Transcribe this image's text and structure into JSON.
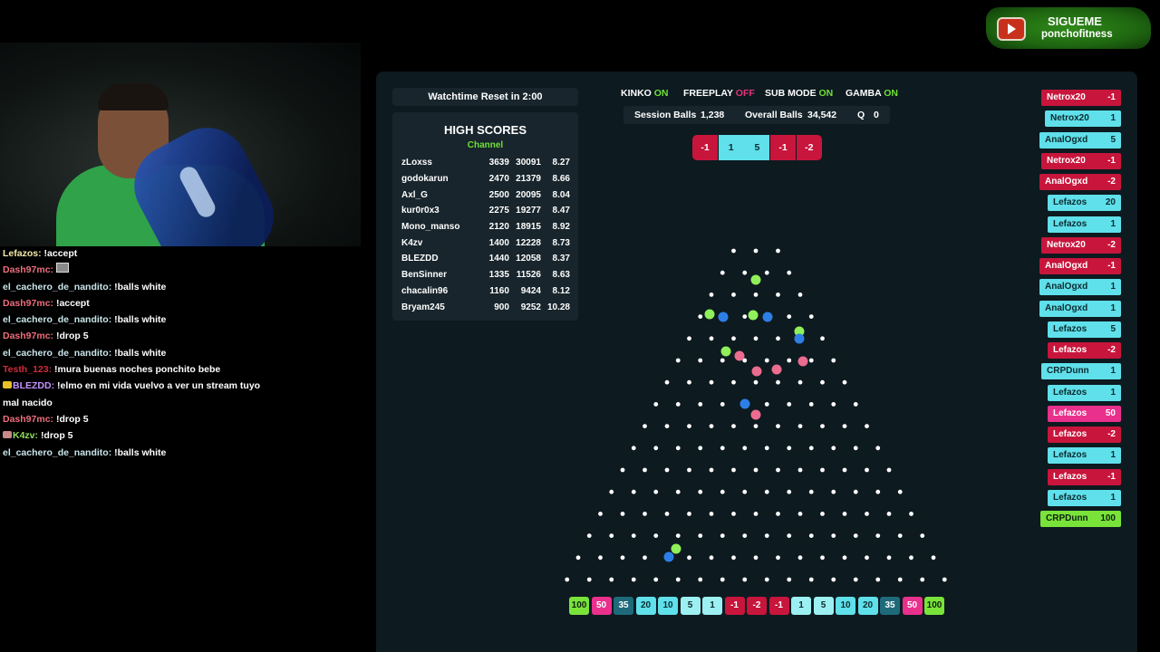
{
  "colors": {
    "panel_bg": "#0d1a20",
    "box_bg": "#18252c",
    "green": "#79e33a",
    "magenta": "#e8308c",
    "teal_dark": "#1e6a7a",
    "cyan": "#5fe0ea",
    "cyan_light": "#9cf0f2",
    "red": "#c8153c",
    "peg": "#ffffff",
    "ball_green": "#8ff05a",
    "ball_blue": "#2d7fe6",
    "ball_pink": "#ea6c8e"
  },
  "follow": {
    "line1": "SIGUEME",
    "line2": "ponchofitness",
    "icon": "youtube-icon"
  },
  "chat": [
    {
      "user": "Lefazos:",
      "color": "#f5e9a8",
      "msg": "!accept"
    },
    {
      "user": "Dash97mc:",
      "color": "#ee6e7e",
      "msg": "",
      "emote": "emote-icon"
    },
    {
      "user": "el_cachero_de_nandito:",
      "color": "#c9e6ea",
      "msg": "!balls white"
    },
    {
      "user": "Dash97mc:",
      "color": "#ee6e7e",
      "msg": "!accept"
    },
    {
      "user": "el_cachero_de_nandito:",
      "color": "#c9e6ea",
      "msg": "!balls white"
    },
    {
      "user": "Dash97mc:",
      "color": "#ee6e7e",
      "msg": "!drop 5"
    },
    {
      "user": "el_cachero_de_nandito:",
      "color": "#c9e6ea",
      "msg": "!balls white"
    },
    {
      "user": "Testh_123:",
      "color": "#d12a3c",
      "msg": "!mura buenas noches ponchito bebe"
    },
    {
      "user": "BLEZDD:",
      "color": "#c591ff",
      "msg": "!elmo en mi vida vuelvo a ver un stream tuyo mal nacido",
      "badge": "crown-badge-icon"
    },
    {
      "user": "Dash97mc:",
      "color": "#ee6e7e",
      "msg": "!drop 5"
    },
    {
      "user": "K4zv:",
      "color": "#8fe05a",
      "msg": "!drop 5",
      "badge": "sub-badge-icon"
    },
    {
      "user": "el_cachero_de_nandito:",
      "color": "#c9e6ea",
      "msg": "!balls white"
    }
  ],
  "watchtime": "Watchtime Reset in  2:00",
  "high_scores": {
    "title": "HIGH SCORES",
    "subtitle": "Channel",
    "rows": [
      [
        "zLoxss",
        "3639",
        "30091",
        "8.27"
      ],
      [
        "godokarun",
        "2470",
        "21379",
        "8.66"
      ],
      [
        "Axl_G",
        "2500",
        "20095",
        "8.04"
      ],
      [
        "kur0r0x3",
        "2275",
        "19277",
        "8.47"
      ],
      [
        "Mono_manso",
        "2120",
        "18915",
        "8.92"
      ],
      [
        "K4zv",
        "1400",
        "12228",
        "8.73"
      ],
      [
        "BLEZDD",
        "1440",
        "12058",
        "8.37"
      ],
      [
        "BenSinner",
        "1335",
        "11526",
        "8.63"
      ],
      [
        "chacalin96",
        "1160",
        "9424",
        "8.12"
      ],
      [
        "Bryam245",
        "900",
        "9252",
        "10.28"
      ]
    ]
  },
  "toggles": [
    {
      "label": "KINKO",
      "state": "ON"
    },
    {
      "label": "FREEPLAY",
      "state": "OFF"
    },
    {
      "label": "SUB MODE",
      "state": "ON"
    },
    {
      "label": "GAMBA",
      "state": "ON"
    }
  ],
  "stats": {
    "session_label": "Session Balls",
    "session": "1,238",
    "overall_label": "Overall Balls",
    "overall": "34,542",
    "q_label": "Q",
    "q": "0"
  },
  "recent_hits": [
    {
      "value": "-1",
      "color": "#c8153c"
    },
    {
      "value": "1",
      "color": "#5fe0ea"
    },
    {
      "value": "5",
      "color": "#5fe0ea"
    },
    {
      "value": "-1",
      "color": "#c8153c"
    },
    {
      "value": "-2",
      "color": "#c8153c"
    }
  ],
  "slots": [
    {
      "value": "100",
      "color": "#79e33a",
      "text": "#102010"
    },
    {
      "value": "50",
      "color": "#e8308c",
      "text": "#ffffff"
    },
    {
      "value": "35",
      "color": "#1e6a7a",
      "text": "#ffffff"
    },
    {
      "value": "20",
      "color": "#5fe0ea",
      "text": "#0d2a30"
    },
    {
      "value": "10",
      "color": "#5fe0ea",
      "text": "#0d2a30"
    },
    {
      "value": "5",
      "color": "#9cf0f2",
      "text": "#0d2a30"
    },
    {
      "value": "1",
      "color": "#9cf0f2",
      "text": "#0d2a30"
    },
    {
      "value": "-1",
      "color": "#c8153c",
      "text": "#ffffff"
    },
    {
      "value": "-2",
      "color": "#c8153c",
      "text": "#ffffff"
    },
    {
      "value": "-1",
      "color": "#c8153c",
      "text": "#ffffff"
    },
    {
      "value": "1",
      "color": "#9cf0f2",
      "text": "#0d2a30"
    },
    {
      "value": "5",
      "color": "#9cf0f2",
      "text": "#0d2a30"
    },
    {
      "value": "10",
      "color": "#5fe0ea",
      "text": "#0d2a30"
    },
    {
      "value": "20",
      "color": "#5fe0ea",
      "text": "#0d2a30"
    },
    {
      "value": "35",
      "color": "#1e6a7a",
      "text": "#ffffff"
    },
    {
      "value": "50",
      "color": "#e8308c",
      "text": "#ffffff"
    },
    {
      "value": "100",
      "color": "#79e33a",
      "text": "#102010"
    }
  ],
  "feed": [
    {
      "name": "Netrox20",
      "value": "-1",
      "color": "#c8153c",
      "text": "#ffffff"
    },
    {
      "name": "Netrox20",
      "value": "1",
      "color": "#5fe0ea",
      "text": "#0d2a30"
    },
    {
      "name": "AnalOgxd",
      "value": "5",
      "color": "#5fe0ea",
      "text": "#0d2a30"
    },
    {
      "name": "Netrox20",
      "value": "-1",
      "color": "#c8153c",
      "text": "#ffffff"
    },
    {
      "name": "AnalOgxd",
      "value": "-2",
      "color": "#c8153c",
      "text": "#ffffff"
    },
    {
      "name": "Lefazos",
      "value": "20",
      "color": "#5fe0ea",
      "text": "#0d2a30"
    },
    {
      "name": "Lefazos",
      "value": "1",
      "color": "#5fe0ea",
      "text": "#0d2a30"
    },
    {
      "name": "Netrox20",
      "value": "-2",
      "color": "#c8153c",
      "text": "#ffffff"
    },
    {
      "name": "AnalOgxd",
      "value": "-1",
      "color": "#c8153c",
      "text": "#ffffff"
    },
    {
      "name": "AnalOgxd",
      "value": "1",
      "color": "#5fe0ea",
      "text": "#0d2a30"
    },
    {
      "name": "AnalOgxd",
      "value": "1",
      "color": "#5fe0ea",
      "text": "#0d2a30"
    },
    {
      "name": "Lefazos",
      "value": "5",
      "color": "#5fe0ea",
      "text": "#0d2a30"
    },
    {
      "name": "Lefazos",
      "value": "-2",
      "color": "#c8153c",
      "text": "#ffffff"
    },
    {
      "name": "CRPDunn",
      "value": "1",
      "color": "#5fe0ea",
      "text": "#0d2a30"
    },
    {
      "name": "Lefazos",
      "value": "1",
      "color": "#5fe0ea",
      "text": "#0d2a30"
    },
    {
      "name": "Lefazos",
      "value": "50",
      "color": "#e8308c",
      "text": "#ffffff"
    },
    {
      "name": "Lefazos",
      "value": "-2",
      "color": "#c8153c",
      "text": "#ffffff"
    },
    {
      "name": "Lefazos",
      "value": "1",
      "color": "#5fe0ea",
      "text": "#0d2a30"
    },
    {
      "name": "Lefazos",
      "value": "-1",
      "color": "#c8153c",
      "text": "#ffffff"
    },
    {
      "name": "Lefazos",
      "value": "1",
      "color": "#5fe0ea",
      "text": "#0d2a30"
    },
    {
      "name": "CRPDunn",
      "value": "100",
      "color": "#79e33a",
      "text": "#102010"
    }
  ]
}
